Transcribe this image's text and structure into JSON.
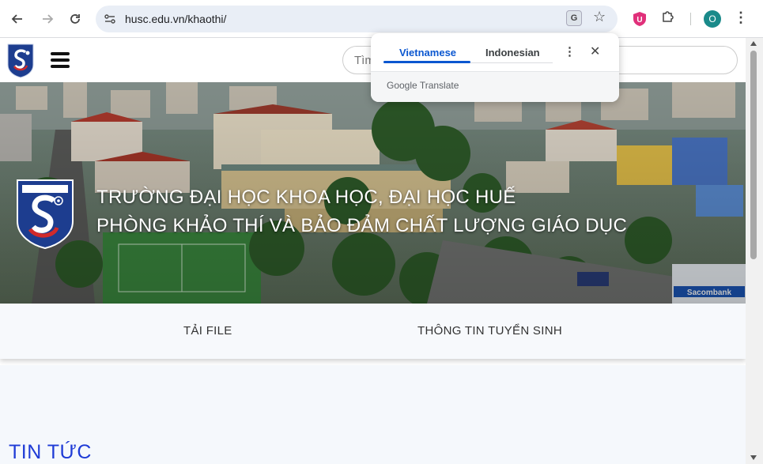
{
  "browser": {
    "url": "husc.edu.vn/khaothi/",
    "profile_initial": "O",
    "icons": [
      "back-icon",
      "forward-icon",
      "reload-icon",
      "site-settings-icon",
      "translate-icon",
      "star-icon",
      "extension-shield-icon",
      "puzzle-icon",
      "kebab-icon"
    ]
  },
  "translate_popup": {
    "tab_active": "Vietnamese",
    "tab_other": "Indonesian",
    "brand": "Google",
    "brand_suffix": " Translate",
    "accent": "#0b57d0"
  },
  "site": {
    "search_placeholder": "Tìm",
    "banner_title": "TRƯỜNG ĐẠI HỌC KHOA HỌC, ĐẠI HỌC HUẾ",
    "banner_subtitle": "PHÒNG KHẢO THÍ VÀ BẢO ĐẢM CHẤT LƯỢNG GIÁO DỤC",
    "menu": [
      {
        "label": "TẢI FILE"
      },
      {
        "label": "THÔNG TIN TUYỂN SINH"
      }
    ],
    "news_heading": "TIN TỨC",
    "heading_color": "#1f3bd6"
  }
}
